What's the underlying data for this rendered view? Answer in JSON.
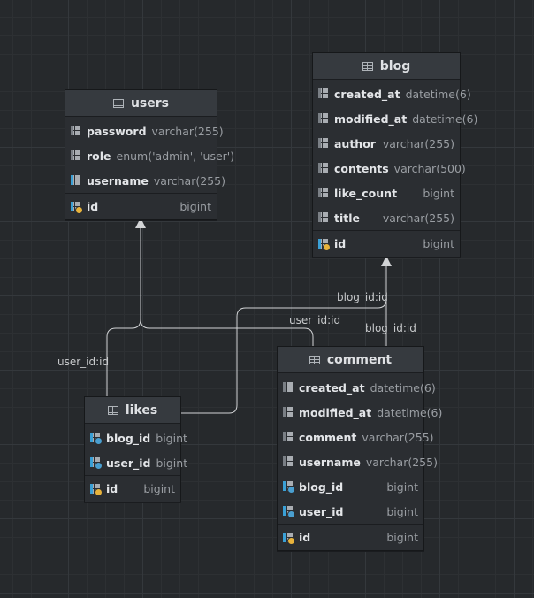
{
  "tables": {
    "users": {
      "name": "users",
      "columns": [
        {
          "name": "password",
          "type": "varchar(255)"
        },
        {
          "name": "role",
          "type": "enum('admin', 'user')"
        },
        {
          "name": "username",
          "type": "varchar(255)"
        },
        {
          "name": "id",
          "type": "bigint"
        }
      ]
    },
    "blog": {
      "name": "blog",
      "columns": [
        {
          "name": "created_at",
          "type": "datetime(6)"
        },
        {
          "name": "modified_at",
          "type": "datetime(6)"
        },
        {
          "name": "author",
          "type": "varchar(255)"
        },
        {
          "name": "contents",
          "type": "varchar(500)"
        },
        {
          "name": "like_count",
          "type": "bigint"
        },
        {
          "name": "title",
          "type": "varchar(255)"
        },
        {
          "name": "id",
          "type": "bigint"
        }
      ]
    },
    "likes": {
      "name": "likes",
      "columns": [
        {
          "name": "blog_id",
          "type": "bigint"
        },
        {
          "name": "user_id",
          "type": "bigint"
        },
        {
          "name": "id",
          "type": "bigint"
        }
      ]
    },
    "comment": {
      "name": "comment",
      "columns": [
        {
          "name": "created_at",
          "type": "datetime(6)"
        },
        {
          "name": "modified_at",
          "type": "datetime(6)"
        },
        {
          "name": "comment",
          "type": "varchar(255)"
        },
        {
          "name": "username",
          "type": "varchar(255)"
        },
        {
          "name": "blog_id",
          "type": "bigint"
        },
        {
          "name": "user_id",
          "type": "bigint"
        },
        {
          "name": "id",
          "type": "bigint"
        }
      ]
    }
  },
  "relations": {
    "likes_users": "user_id:id",
    "likes_blog": "blog_id:id",
    "comment_users": "user_id:id",
    "comment_blog": "blog_id:id"
  },
  "colors": {
    "canvas": "#26292c",
    "table_header": "#363a3f",
    "table_body": "#2b2e32",
    "primary_key": "#e8b33c",
    "foreign_key": "#3aa0d6"
  }
}
